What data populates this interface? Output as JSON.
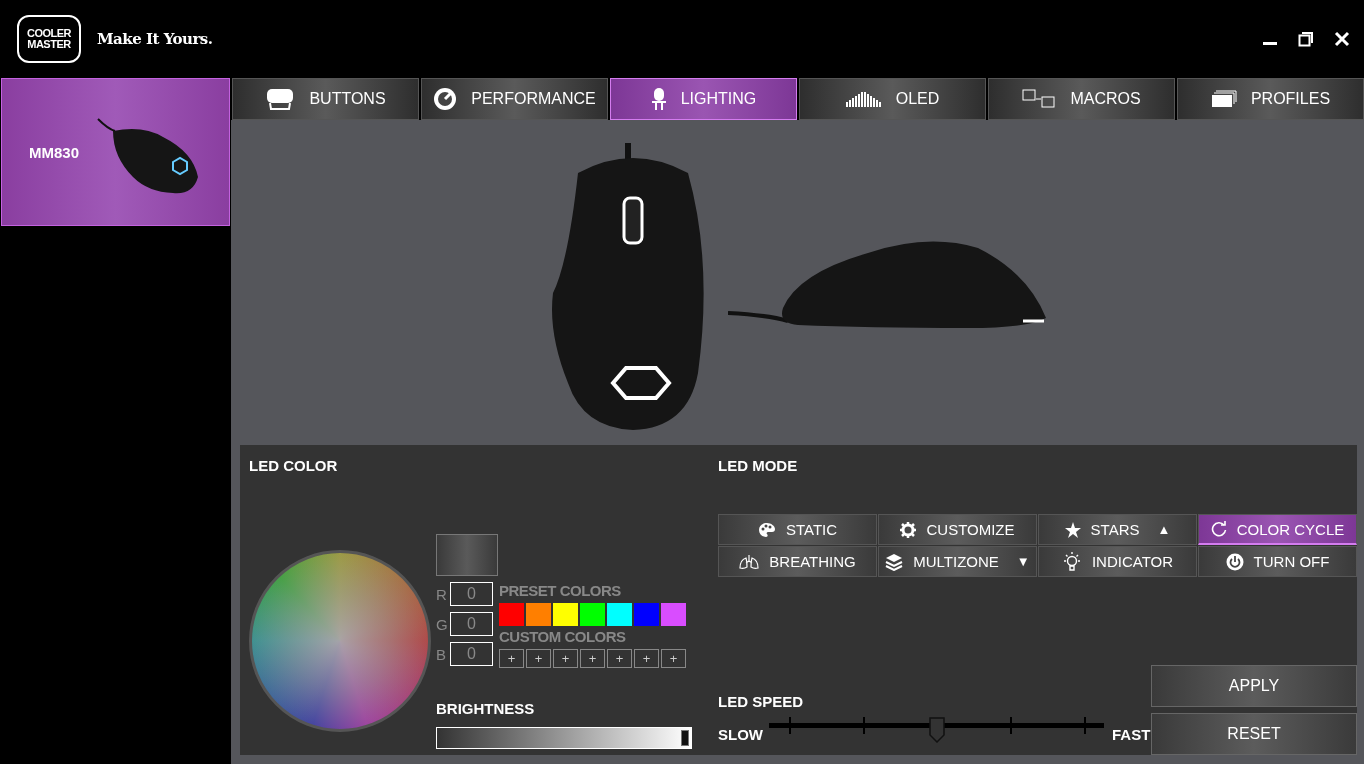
{
  "header": {
    "logo_lines": [
      "COOLER",
      "MASTER"
    ],
    "tagline": "Make It Yours."
  },
  "sidebar": {
    "devices": [
      {
        "name": "MM830",
        "selected": true
      }
    ]
  },
  "tabs": [
    {
      "label": "BUTTONS",
      "selected": false
    },
    {
      "label": "PERFORMANCE",
      "selected": false
    },
    {
      "label": "LIGHTING",
      "selected": true
    },
    {
      "label": "OLED",
      "selected": false
    },
    {
      "label": "MACROS",
      "selected": false
    },
    {
      "label": "PROFILES",
      "selected": false
    }
  ],
  "led_color": {
    "title": "LED COLOR",
    "rgb": [
      {
        "label": "R",
        "value": "0"
      },
      {
        "label": "G",
        "value": "0"
      },
      {
        "label": "B",
        "value": "0"
      }
    ],
    "preset_title": "PRESET COLORS",
    "presets": [
      {
        "color": "#ff0000"
      },
      {
        "color": "#ff7f00"
      },
      {
        "color": "#ffff00"
      },
      {
        "color": "#00ff00"
      },
      {
        "color": "#00ffff"
      },
      {
        "color": "#0000ff"
      },
      {
        "color": "#d94dff"
      }
    ],
    "custom_title": "CUSTOM COLORS",
    "custom_slots": [
      "+",
      "+",
      "+",
      "+",
      "+",
      "+",
      "+"
    ],
    "brightness_title": "BRIGHTNESS",
    "brightness": {
      "level": 1
    }
  },
  "led_mode": {
    "title": "LED MODE",
    "modes": [
      {
        "label": "STATIC",
        "selected": false
      },
      {
        "label": "CUSTOMIZE",
        "selected": false
      },
      {
        "label": "STARS",
        "selected": false,
        "arrow": "▲"
      },
      {
        "label": "COLOR CYCLE",
        "selected": true
      },
      {
        "label": "BREATHING",
        "selected": false
      },
      {
        "label": "MULTIZONE",
        "selected": false,
        "arrow": "▼"
      },
      {
        "label": "INDICATOR",
        "selected": false
      },
      {
        "label": "TURN OFF",
        "selected": false
      }
    ]
  },
  "led_speed": {
    "title": "LED SPEED",
    "slow": "SLOW",
    "fast": "FAST",
    "level": 0.5
  },
  "buttons": [
    "APPLY",
    "RESET"
  ]
}
